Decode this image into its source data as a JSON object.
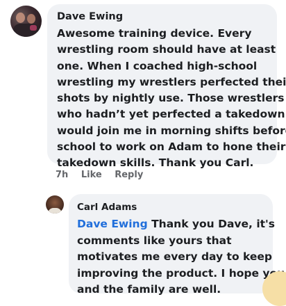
{
  "comment": {
    "author": "Dave Ewing",
    "lines": [
      "Awesome training device. Every",
      "wrestling room should have at least",
      "one. When I coached high-school",
      "wrestling my wrestlers perfected their",
      "shots by nightly use. Those wrestlers",
      "who hadn’t yet perfected a takedown",
      "would join me in morning shifts before",
      "school to work on Adam to hone their",
      "takedown skills. Thank you Carl."
    ],
    "timestamp": "7h",
    "like_label": "Like",
    "reply_label": "Reply"
  },
  "reply": {
    "author": "Carl Adams",
    "mention": "Dave Ewing",
    "first_line_rest": " Thank you Dave, it's",
    "lines": [
      "comments like yours that",
      "motivates me every day to keep",
      "improving the product. I hope you",
      "and the family are well."
    ]
  },
  "colors": {
    "bubble": "#f0f2f5",
    "text": "#1c1e21",
    "secondary": "#65676b",
    "mention": "#216fdb"
  }
}
